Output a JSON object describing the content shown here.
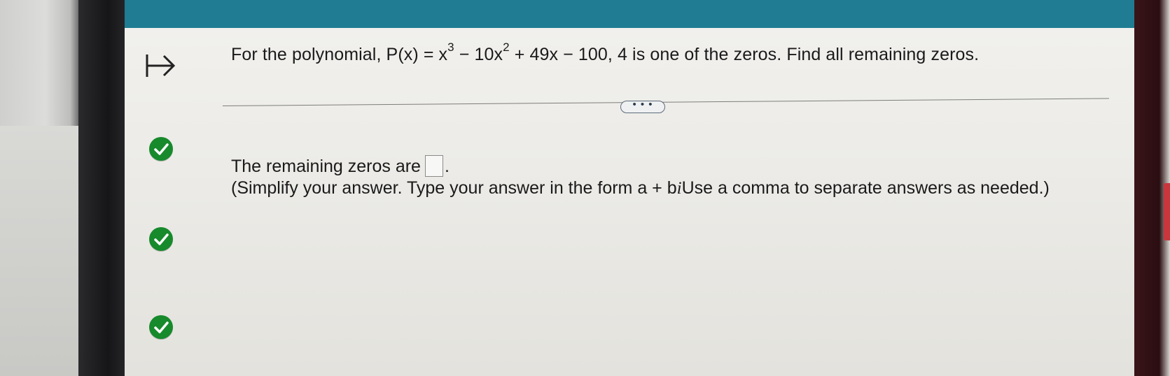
{
  "question": {
    "prefix": "For the polynomial, P(x) = x",
    "exp1": "3",
    "mid1": " − 10x",
    "exp2": "2",
    "suffix": " + 49x − 100, 4 is one of the zeros. Find all remaining zeros."
  },
  "more_button": {
    "label": "• • •"
  },
  "answer": {
    "prompt": "The remaining zeros are",
    "end": ".",
    "value": ""
  },
  "hint": {
    "part1": "(Simplify your answer. Type your answer in the form a + b",
    "italic_i": "i",
    "part2": "Use a comma to separate answers as needed.)"
  },
  "colors": {
    "topbar": "#1f7c93",
    "check": "#178a2c"
  },
  "icons": {
    "arrow": "step-arrow-icon",
    "check": "checkmark-circle-icon"
  }
}
